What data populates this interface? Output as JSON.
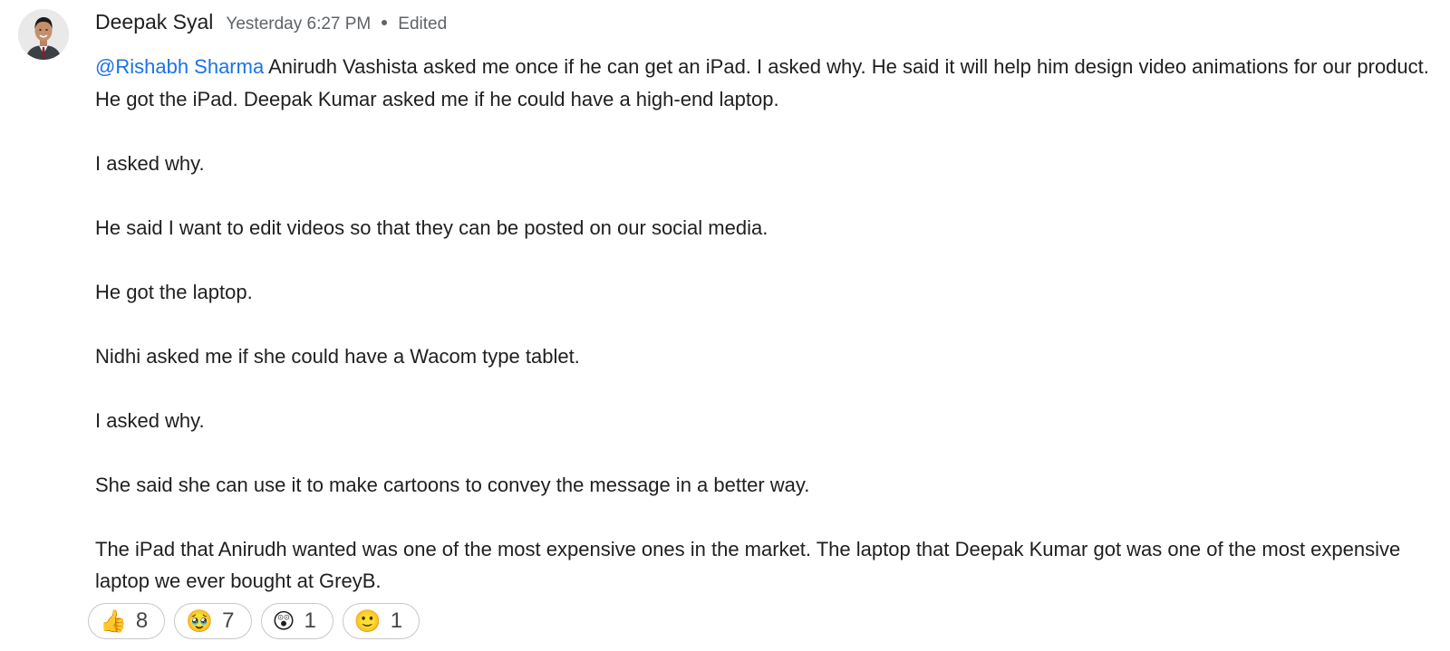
{
  "message": {
    "sender": "Deepak Syal",
    "timestamp": "Yesterday 6:27 PM",
    "edited_label": "Edited",
    "mention": "@Rishabh Sharma",
    "paragraphs": [
      " Anirudh Vashista asked me once if he can get an iPad. I asked why. He said it will help him design video animations for our product. He got the iPad. Deepak Kumar asked me if he could have a high-end laptop.",
      "I asked why.",
      "He said I want to edit videos so that they can be posted on our social media.",
      "He got the laptop.",
      "Nidhi asked me if she could have a Wacom type tablet.",
      "I asked why.",
      "She said she can use it to make cartoons to convey the message in a better way.",
      "The iPad that Anirudh wanted was one of the most expensive ones in the market. The laptop that Deepak Kumar got was one of the most expensive laptop we ever bought at GreyB."
    ]
  },
  "reactions": [
    {
      "emoji": "👍",
      "count": "8",
      "icon": "thumbs-up-icon"
    },
    {
      "emoji": "🥹",
      "count": "7",
      "icon": "holding-back-tears-icon"
    },
    {
      "emoji": "😲",
      "count": "1",
      "icon": "astonished-face-icon"
    },
    {
      "emoji": "🙂",
      "count": "1",
      "icon": "slightly-smiling-face-icon"
    }
  ],
  "colors": {
    "mention": "#1a73e8",
    "meta": "#5f6368",
    "chip_border": "#c7c7c7"
  }
}
